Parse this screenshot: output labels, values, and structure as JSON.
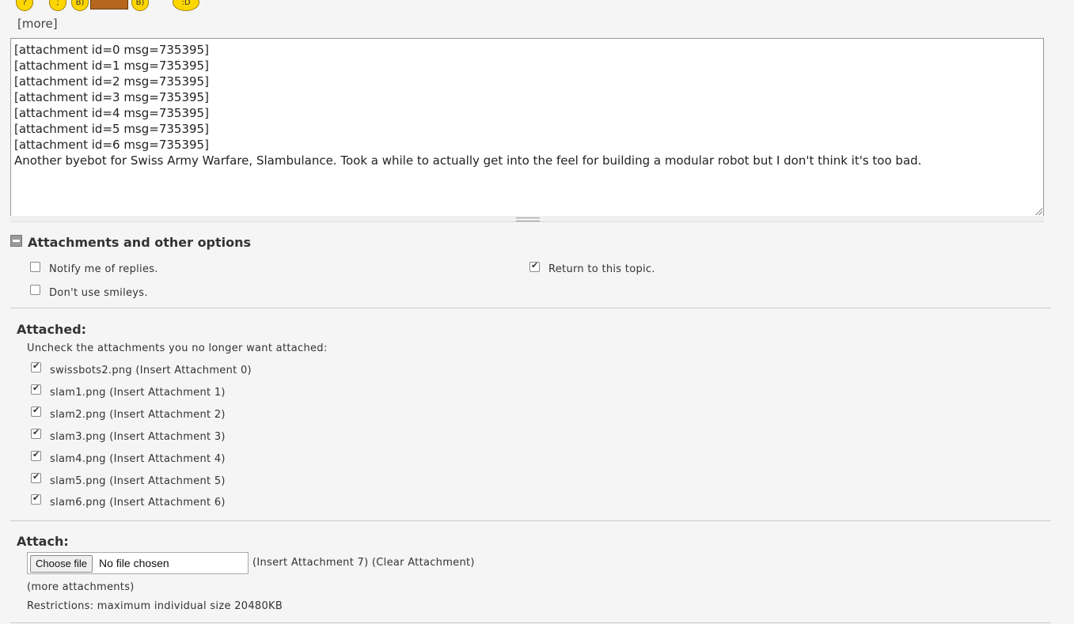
{
  "smileys": {
    "more_label": "[more]"
  },
  "editor": {
    "lines": [
      "[attachment id=0 msg=735395]",
      "[attachment id=1 msg=735395]",
      "[attachment id=2 msg=735395]",
      "[attachment id=3 msg=735395]",
      "[attachment id=4 msg=735395]",
      "[attachment id=5 msg=735395]",
      "[attachment id=6 msg=735395]",
      "Another byebot for Swiss Army Warfare, Slambulance. Took a while to actually get into the feel for building a modular robot but I don't think it's too bad."
    ]
  },
  "options": {
    "title": "Attachments and other options",
    "notify": {
      "label": "Notify me of replies.",
      "checked": false
    },
    "return": {
      "label": "Return to this topic.",
      "checked": true
    },
    "no_smileys": {
      "label": "Don't use smileys.",
      "checked": false
    }
  },
  "attached": {
    "heading": "Attached:",
    "instructions": "Uncheck the attachments you no longer want attached:",
    "items": [
      {
        "label": "swissbots2.png (Insert Attachment 0)",
        "checked": true
      },
      {
        "label": "slam1.png (Insert Attachment 1)",
        "checked": true
      },
      {
        "label": "slam2.png (Insert Attachment 2)",
        "checked": true
      },
      {
        "label": "slam3.png (Insert Attachment 3)",
        "checked": true
      },
      {
        "label": "slam4.png (Insert Attachment 4)",
        "checked": true
      },
      {
        "label": "slam5.png (Insert Attachment 5)",
        "checked": true
      },
      {
        "label": "slam6.png (Insert Attachment 6)",
        "checked": true
      }
    ]
  },
  "attach": {
    "heading": "Attach:",
    "choose_button": "Choose file",
    "file_status": "No file chosen",
    "insert_clear": "(Insert Attachment 7) (Clear Attachment)",
    "more_attachments": "(more attachments)",
    "restrictions": "Restrictions: maximum individual size 20480KB"
  }
}
